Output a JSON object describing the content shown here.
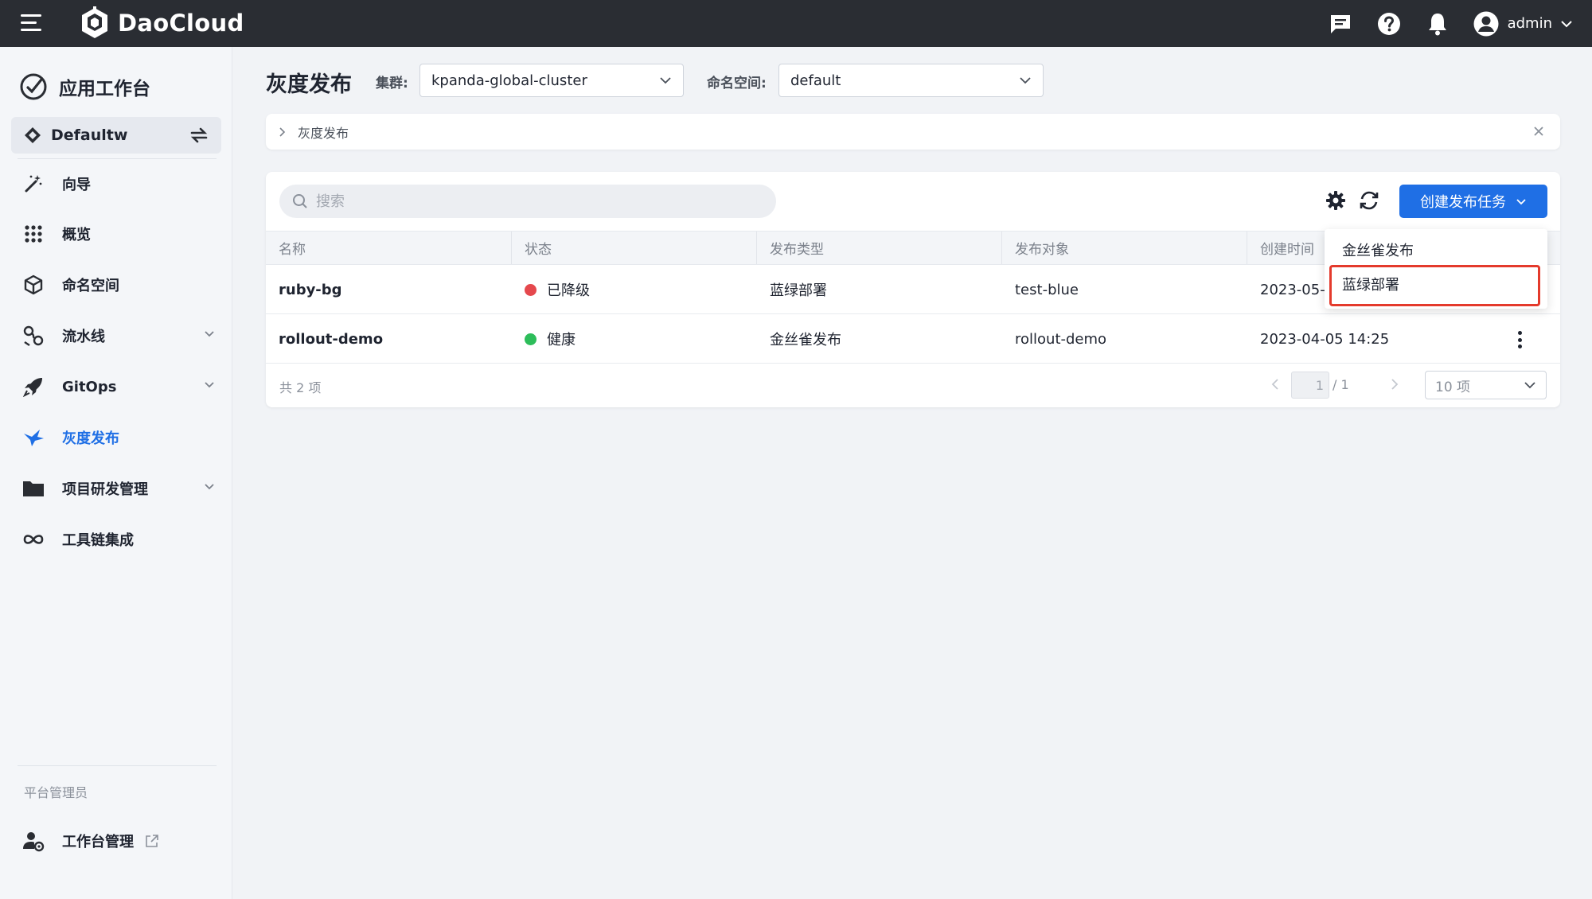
{
  "topbar": {
    "brand": "DaoCloud",
    "user": "admin",
    "icons": [
      "menu-icon",
      "message-icon",
      "help-icon",
      "bell-icon",
      "user-icon",
      "chevron-down-icon"
    ]
  },
  "sidebar": {
    "app_title": "应用工作台",
    "workspace": "Defaultw",
    "items": [
      {
        "label": "向导",
        "icon": "wand-icon"
      },
      {
        "label": "概览",
        "icon": "grid-icon"
      },
      {
        "label": "命名空间",
        "icon": "cube-icon"
      },
      {
        "label": "流水线",
        "icon": "pipeline-icon"
      },
      {
        "label": "GitOps",
        "icon": "rocket-icon"
      },
      {
        "label": "灰度发布",
        "icon": "bird-icon"
      },
      {
        "label": "项目研发管理",
        "icon": "folder-icon"
      },
      {
        "label": "工具链集成",
        "icon": "infinity-icon"
      }
    ],
    "section_label": "平台管理员",
    "admin_item": "工作台管理",
    "active_item": "灰度发布",
    "accent_color": "#1f6fe5"
  },
  "header": {
    "title": "灰度发布",
    "cluster_label": "集群:",
    "cluster_value": "kpanda-global-cluster",
    "namespace_label": "命名空间:",
    "namespace_value": "default"
  },
  "breadcrumb": {
    "text": "灰度发布"
  },
  "toolbar": {
    "search_placeholder": "搜索",
    "create_button": "创建发布任务"
  },
  "table": {
    "columns": [
      "名称",
      "状态",
      "发布类型",
      "发布对象",
      "创建时间"
    ],
    "rows": [
      {
        "name": "ruby-bg",
        "status": "已降级",
        "status_color": "#e5484d",
        "type": "蓝绿部署",
        "target": "test-blue",
        "created": "2023-05-"
      },
      {
        "name": "rollout-demo",
        "status": "健康",
        "status_color": "#2dbd5a",
        "type": "金丝雀发布",
        "target": "rollout-demo",
        "created": "2023-04-05 14:25"
      }
    ]
  },
  "pagination": {
    "total_text": "共 2 项",
    "current_page": "1",
    "total_pages": "/ 1",
    "page_size": "10 项"
  },
  "dropdown": {
    "items": [
      "金丝雀发布",
      "蓝绿部署"
    ],
    "highlight_color": "#e43a2c"
  }
}
